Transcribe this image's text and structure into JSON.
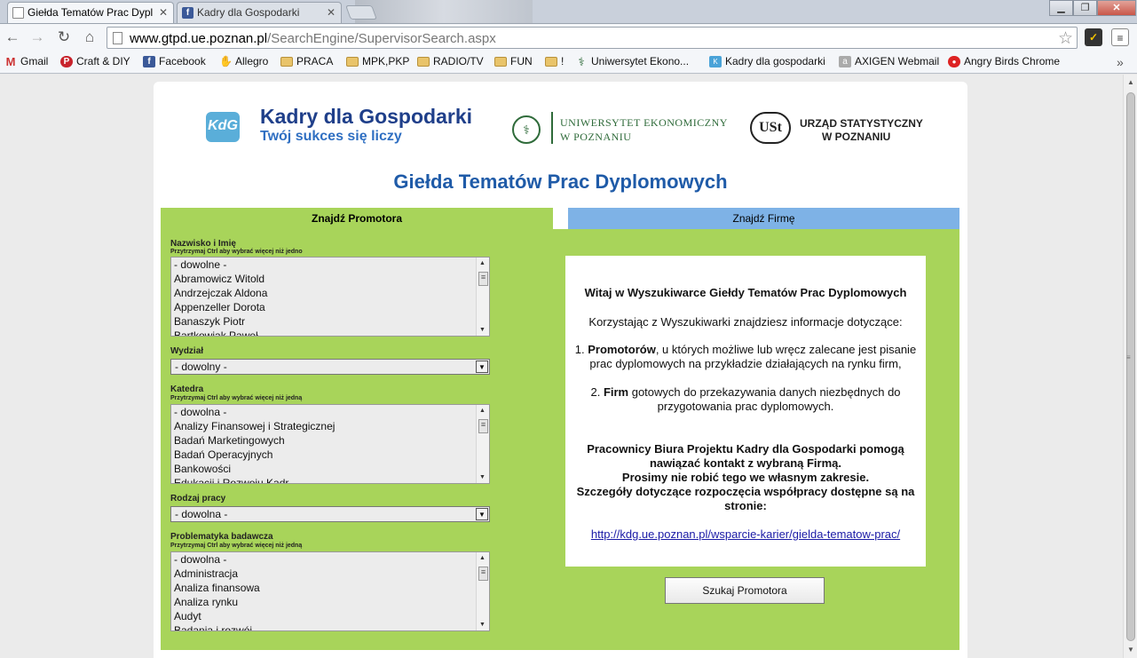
{
  "browser": {
    "tabs": [
      {
        "title": "Giełda Tematów Prac Dypl",
        "icon": "page-icon",
        "active": true
      },
      {
        "title": "Kadry dla Gospodarki",
        "icon": "facebook-icon",
        "active": false
      }
    ],
    "url_host": "www.gtpd.ue.poznan.pl",
    "url_path": "/SearchEngine/SupervisorSearch.aspx",
    "bookmarks": [
      {
        "label": "Gmail",
        "icon": "gmail-icon"
      },
      {
        "label": "Craft & DIY",
        "icon": "pinterest-icon"
      },
      {
        "label": "Facebook",
        "icon": "facebook-icon"
      },
      {
        "label": "Allegro",
        "icon": "allegro-icon"
      },
      {
        "label": "PRACA",
        "icon": "folder-icon"
      },
      {
        "label": "MPK,PKP",
        "icon": "folder-icon"
      },
      {
        "label": "RADIO/TV",
        "icon": "folder-icon"
      },
      {
        "label": "FUN",
        "icon": "folder-icon"
      },
      {
        "label": "!",
        "icon": "folder-icon"
      },
      {
        "label": "Uniwersytet Ekono...",
        "icon": "university-icon"
      },
      {
        "label": "Kadry dla gospodarki",
        "icon": "kdg-icon"
      },
      {
        "label": "AXIGEN Webmail",
        "icon": "axigen-icon"
      },
      {
        "label": "Angry Birds Chrome",
        "icon": "angry-birds-icon"
      }
    ]
  },
  "header": {
    "kdg_logo_text": "KdG",
    "kdg_title": "Kadry dla Gospodarki",
    "kdg_slogan": "Twój sukces się liczy",
    "ue_line1": "UNIWERSYTET EKONOMICZNY",
    "ue_line2": "W POZNANIU",
    "us_logo_text": "USt",
    "us_line1": "URZĄD STATYSTYCZNY",
    "us_line2": "W POZNANIU"
  },
  "page_title": "Giełda Tematów Prac Dyplomowych",
  "form_tabs": {
    "promotor": "Znajdź Promotora",
    "firma": "Znajdź Firmę"
  },
  "form": {
    "name_label": "Nazwisko i Imię",
    "name_hint": "Przytrzymaj Ctrl aby wybrać więcej niż jedno",
    "name_options": [
      "- dowolne -",
      "Abramowicz Witold",
      "Andrzejczak Aldona",
      "Appenzeller Dorota",
      "Banaszyk Piotr",
      "Bartkowiak Paweł"
    ],
    "faculty_label": "Wydział",
    "faculty_value": "- dowolny -",
    "department_label": "Katedra",
    "department_hint": "Przytrzymaj Ctrl aby wybrać więcej niż jedną",
    "department_options": [
      "- dowolna -",
      "Analizy Finansowej i Strategicznej",
      "Badań Marketingowych",
      "Badań Operacyjnych",
      "Bankowości",
      "Edukacji i Rozwoju Kadr"
    ],
    "worktype_label": "Rodzaj pracy",
    "worktype_value": "- dowolna -",
    "research_label": "Problematyka badawcza",
    "research_hint": "Przytrzymaj Ctrl aby wybrać więcej niż jedną",
    "research_options": [
      "- dowolna -",
      "Administracja",
      "Analiza finansowa",
      "Analiza rynku",
      "Audyt",
      "Badania i rozwój"
    ]
  },
  "info": {
    "heading": "Witaj w Wyszukiwarce Giełdy Tematów Prac Dyplomowych",
    "intro": "Korzystając z Wyszukiwarki znajdziesz informacje dotyczące:",
    "item1_num": "1.",
    "item1_bold": "Promotorów",
    "item1_text_a": ", u których możliwe lub wręcz zalecane jest pisanie",
    "item1_text_b": "prac dyplomowych na przykładzie działających na rynku firm,",
    "item2_num": "2.",
    "item2_bold": "Firm",
    "item2_text_a": " gotowych do przekazywania danych niezbędnych do",
    "item2_text_b": "przygotowania prac dyplomowych.",
    "note1": "Pracownicy Biura Projektu Kadry dla Gospodarki pomogą",
    "note2": "nawiązać kontakt z wybraną Firmą.",
    "note3": "Prosimy nie robić tego we własnym zakresie.",
    "note4": "Szczegóły dotyczące rozpoczęcia współpracy dostępne są na",
    "note5": "stronie:",
    "link": "http://kdg.ue.poznan.pl/wsparcie-karier/gielda-tematow-prac/"
  },
  "search_button": "Szukaj Promotora"
}
